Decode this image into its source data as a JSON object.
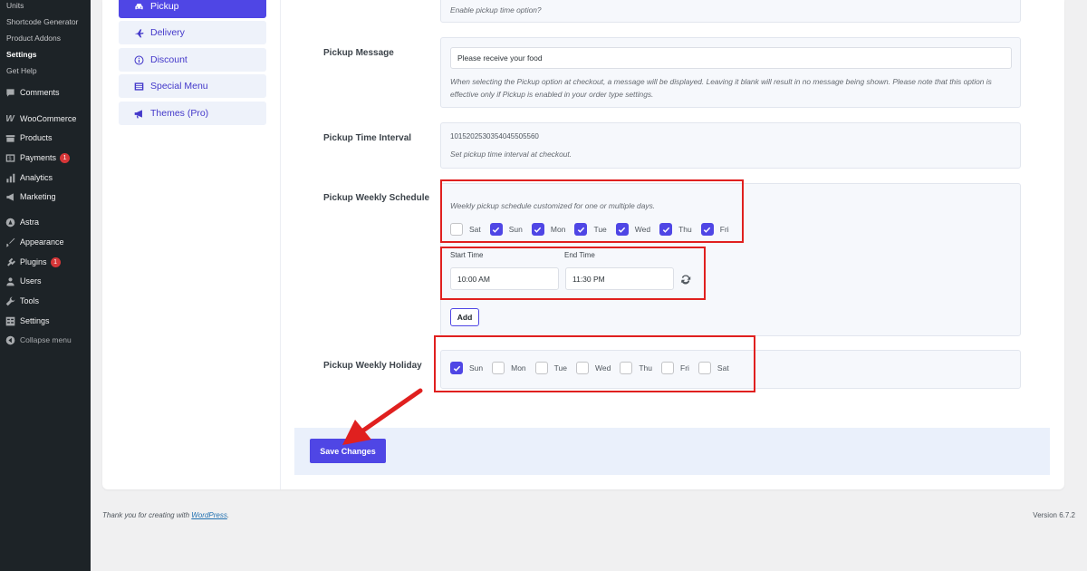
{
  "admin_menu": {
    "submenu": [
      {
        "label": "Units",
        "current": false
      },
      {
        "label": "Shortcode Generator",
        "current": false
      },
      {
        "label": "Product Addons",
        "current": false
      },
      {
        "label": "Settings",
        "current": true
      },
      {
        "label": "Get Help",
        "current": false
      }
    ],
    "items": [
      {
        "label": "Comments",
        "icon": "comments-icon"
      },
      {
        "label": "WooCommerce",
        "icon": "woocommerce-icon"
      },
      {
        "label": "Products",
        "icon": "products-icon"
      },
      {
        "label": "Payments",
        "icon": "payments-icon",
        "badge": "1"
      },
      {
        "label": "Analytics",
        "icon": "analytics-icon"
      },
      {
        "label": "Marketing",
        "icon": "marketing-icon"
      },
      {
        "label": "Astra",
        "icon": "astra-icon"
      },
      {
        "label": "Appearance",
        "icon": "appearance-icon"
      },
      {
        "label": "Plugins",
        "icon": "plugins-icon",
        "badge": "1"
      },
      {
        "label": "Users",
        "icon": "users-icon"
      },
      {
        "label": "Tools",
        "icon": "tools-icon"
      },
      {
        "label": "Settings",
        "icon": "settings-icon"
      }
    ],
    "collapse_label": "Collapse menu"
  },
  "plugin_tabs": [
    {
      "label": "Pickup",
      "icon": "car-icon",
      "active": true
    },
    {
      "label": "Delivery",
      "icon": "plane-icon",
      "active": false
    },
    {
      "label": "Discount",
      "icon": "info-icon",
      "active": false
    },
    {
      "label": "Special Menu",
      "icon": "menu-icon",
      "active": false
    },
    {
      "label": "Themes (Pro)",
      "icon": "megaphone-icon",
      "active": false
    }
  ],
  "settings": {
    "pickup_time_option": {
      "help": "Enable pickup time option?"
    },
    "pickup_message": {
      "label": "Pickup Message",
      "value": "Please receive your food",
      "help": "When selecting the Pickup option at checkout, a message will be displayed. Leaving it blank will result in no message being shown. Please note that this option is effective only if Pickup is enabled in your order type settings."
    },
    "pickup_time_interval": {
      "label": "Pickup Time Interval",
      "value": "1015202530354045505560",
      "help": "Set pickup time interval at checkout."
    },
    "pickup_weekly_schedule": {
      "label": "Pickup Weekly Schedule",
      "help": "Weekly pickup schedule customized for one or multiple days.",
      "days": [
        {
          "label": "Sat",
          "checked": false
        },
        {
          "label": "Sun",
          "checked": true
        },
        {
          "label": "Mon",
          "checked": true
        },
        {
          "label": "Tue",
          "checked": true
        },
        {
          "label": "Wed",
          "checked": true
        },
        {
          "label": "Thu",
          "checked": true
        },
        {
          "label": "Fri",
          "checked": true
        }
      ],
      "start_time_label": "Start Time",
      "end_time_label": "End Time",
      "start_time": "10:00 AM",
      "end_time": "11:30 PM",
      "add_label": "Add"
    },
    "pickup_weekly_holiday": {
      "label": "Pickup Weekly Holiday",
      "days": [
        {
          "label": "Sun",
          "checked": true
        },
        {
          "label": "Mon",
          "checked": false
        },
        {
          "label": "Tue",
          "checked": false
        },
        {
          "label": "Wed",
          "checked": false
        },
        {
          "label": "Thu",
          "checked": false
        },
        {
          "label": "Fri",
          "checked": false
        },
        {
          "label": "Sat",
          "checked": false
        }
      ]
    }
  },
  "save_label": "Save Changes",
  "footer": {
    "thanks_prefix": "Thank you for creating with ",
    "thanks_link": "WordPress",
    "thanks_suffix": ".",
    "version": "Version 6.7.2"
  },
  "colors": {
    "accent": "#4f46e5",
    "annotation_red": "#e0201f",
    "admin_bg": "#1d2327"
  }
}
